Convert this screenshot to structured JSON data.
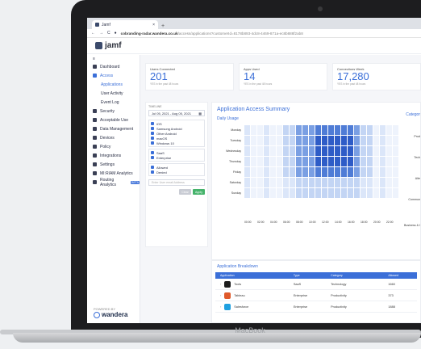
{
  "browser": {
    "tab_title": "Jamf",
    "new_tab": "+",
    "url_main": "cobranding-radar.wandera.co.uk",
    "url_rest": "/access/applications?customerId=8178b893-4dc8-4469-871a-ec8b888f2ab8"
  },
  "app": {
    "logo": "jamf"
  },
  "sidebar": {
    "items": [
      {
        "label": "Dashboard",
        "icon": "dashboard-icon"
      },
      {
        "label": "Access",
        "icon": "access-icon",
        "active": true
      },
      {
        "label": "Applications",
        "sub": true,
        "active": true
      },
      {
        "label": "User Activity",
        "sub": true
      },
      {
        "label": "Event Log",
        "sub": true
      },
      {
        "label": "Security",
        "icon": "lock-icon"
      },
      {
        "label": "Acceptable Use",
        "icon": "cloud-icon"
      },
      {
        "label": "Data Management",
        "icon": "bars-icon"
      },
      {
        "label": "Devices",
        "icon": "devices-icon"
      },
      {
        "label": "Policy",
        "icon": "policy-icon"
      },
      {
        "label": "Integrations",
        "icon": "share-icon"
      },
      {
        "label": "Settings",
        "icon": "gear-icon"
      },
      {
        "label": "MI:RIAM Analytics",
        "icon": "miriam-icon"
      },
      {
        "label": "Routing Analytics",
        "icon": "routing-icon",
        "badge": "BETA"
      }
    ],
    "footer_small": "POWERED BY",
    "footer_brand": "wandera"
  },
  "stats": [
    {
      "label": "Users Connected",
      "value": "201",
      "sub": "YES in the past 48 hours"
    },
    {
      "label": "Apps Used",
      "value": "14",
      "sub": "YES in the past 48 hours"
    },
    {
      "label": "Connections Week",
      "value": "17,280",
      "sub": "YES in the past 48 hours"
    }
  ],
  "filters": {
    "timeline_label": "TIMELINE",
    "date_range": "Jul 05, 2021 - Aug 05, 2021",
    "groups": [
      [
        "iOS",
        "Samsung Android",
        "Other Android",
        "macOS",
        "Windows 10"
      ],
      [
        "SaaS",
        "Enterprise"
      ],
      [
        "Allowed",
        "Denied"
      ]
    ],
    "email_placeholder": "Enter User email Address",
    "clear": "Clear",
    "apply": "Apply"
  },
  "summary": {
    "title": "Application Access Summary",
    "daily_usage": "Daily Usage",
    "category_label": "Categor",
    "category_items": [
      "Prod",
      "Tech",
      "Alte",
      "Commun",
      "Business & I"
    ],
    "days": [
      "Monday",
      "Tuesday",
      "Wednesday",
      "Thursday",
      "Friday",
      "Saturday",
      "Sunday"
    ],
    "hours": [
      "00:00",
      "02:00",
      "04:00",
      "06:00",
      "08:00",
      "10:00",
      "12:00",
      "14:00",
      "16:00",
      "18:00",
      "20:00",
      "22:00"
    ],
    "colors": {
      "accent": "#3b6fd8",
      "heat_low": "#eaf0fb",
      "heat_high": "#1f4fc0"
    }
  },
  "breakdown": {
    "title": "Application Breakdown",
    "headers": [
      "Application",
      "Type",
      "Category",
      "Allowed"
    ],
    "rows": [
      {
        "name": "Tools",
        "type": "SaaS",
        "category": "Technology",
        "allowed": "1660",
        "color": "#1c1c1c"
      },
      {
        "name": "Tableau",
        "type": "Enterprise",
        "category": "Productivity",
        "allowed": "373",
        "color": "#e05a2a"
      },
      {
        "name": "Salesforce",
        "type": "Enterprise",
        "category": "Productivity",
        "allowed": "1888",
        "color": "#1fa0e0"
      }
    ]
  }
}
